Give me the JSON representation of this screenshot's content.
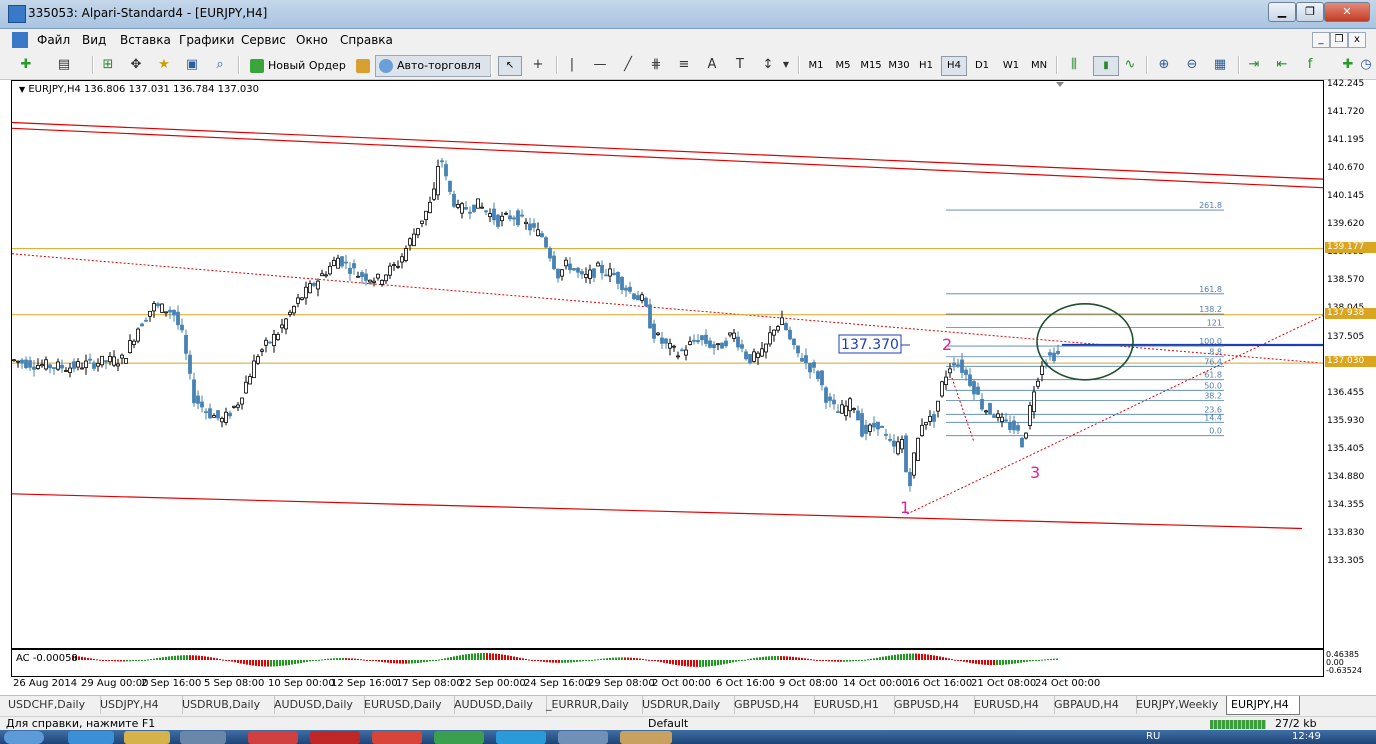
{
  "window": {
    "title": "335053: Alpari-Standard4 - [EURJPY,H4]",
    "buttons": {
      "minimize": "▁",
      "maximize": "❐",
      "close": "✕"
    }
  },
  "menu": {
    "items": [
      "Файл",
      "Вид",
      "Вставка",
      "Графики",
      "Сервис",
      "Окно",
      "Справка"
    ]
  },
  "toolbar": {
    "new_order": "Новый Ордер",
    "autotrading": "Авто-торговля",
    "timeframes": [
      "M1",
      "M5",
      "M15",
      "M30",
      "H1",
      "H4",
      "D1",
      "W1",
      "MN"
    ],
    "active_timeframe": "H4"
  },
  "chart": {
    "symbol_info": "EURJPY,H4  136.806 137.031 136.784 137.030",
    "price_ticks": [
      "142.245",
      "141.720",
      "141.195",
      "140.670",
      "140.145",
      "139.620",
      "139.095",
      "138.570",
      "138.045",
      "137.505",
      "136.980",
      "136.455",
      "135.930",
      "135.405",
      "134.880",
      "134.355",
      "133.830",
      "133.305"
    ],
    "price_tags": [
      {
        "label": "139.177",
        "price": 139.177
      },
      {
        "label": "137.938",
        "price": 137.938
      },
      {
        "label": "137.030",
        "price": 137.03
      }
    ],
    "price_box": "137.370",
    "wave_labels": {
      "one": "1",
      "two": "2",
      "three": "3"
    },
    "fib_levels": [
      {
        "label": "261.8",
        "price": 139.9
      },
      {
        "label": "161.8",
        "price": 138.33
      },
      {
        "label": "138.2",
        "price": 137.95
      },
      {
        "label": "121",
        "price": 137.7
      },
      {
        "label": "100.0",
        "price": 137.35
      },
      {
        "label": "8.8",
        "price": 137.15
      },
      {
        "label": "76.4",
        "price": 136.97
      },
      {
        "label": "61.8",
        "price": 136.72
      },
      {
        "label": "50.0",
        "price": 136.52
      },
      {
        "label": "38.2",
        "price": 136.33
      },
      {
        "label": "23.6",
        "price": 136.07
      },
      {
        "label": "14.4",
        "price": 135.92
      },
      {
        "label": "0.0",
        "price": 135.67
      }
    ],
    "time_labels": [
      "26 Aug 2014",
      "29 Aug 00:00",
      "2 Sep 16:00",
      "5 Sep 08:00",
      "10 Sep 00:00",
      "12 Sep 16:00",
      "17 Sep 08:00",
      "22 Sep 00:00",
      "24 Sep 16:00",
      "29 Sep 08:00",
      "2 Oct 00:00",
      "6 Oct 16:00",
      "9 Oct 08:00",
      "14 Oct 00:00",
      "16 Oct 16:00",
      "21 Oct 08:00",
      "24 Oct 00:00"
    ],
    "colors": {
      "bull": "#000000",
      "bear": "#4682b4",
      "channel": "#e00000",
      "level": "#daa520",
      "fib": "#4f7fb0",
      "wave": "#e0209a"
    }
  },
  "indicator": {
    "label": "AC -0.00058",
    "scale_top": "0.46385",
    "scale_mid": "0.00",
    "scale_bottom": "-0.63524"
  },
  "tabs": [
    "USDCHF,Daily",
    "USDJPY,H4",
    "USDRUB,Daily",
    "AUDUSD,Daily",
    "EURUSD,Daily",
    "AUDUSD,Daily",
    "_EURRUR,Daily",
    "USDRUR,Daily",
    "GBPUSD,H4",
    "EURUSD,H1",
    "GBPUSD,H4",
    "EURUSD,H4",
    "GBPAUD,H4",
    "EURJPY,Weekly",
    "EURJPY,H4"
  ],
  "active_tab": "EURJPY,H4",
  "status": {
    "help": "Для справки, нажмите F1",
    "profile": "Default",
    "traffic": "27/2 kb"
  },
  "taskbar": {
    "clock": "12:49",
    "lang": "RU"
  }
}
